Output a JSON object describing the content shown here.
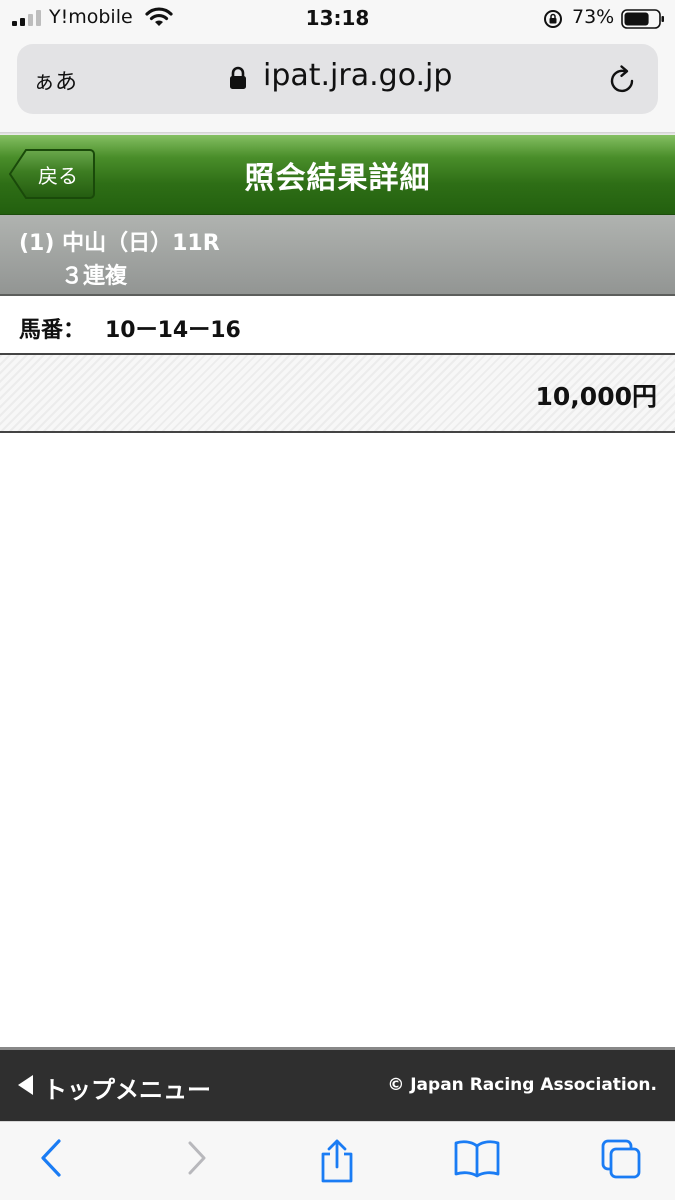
{
  "status_bar": {
    "carrier": "Y!mobile",
    "time": "13:18",
    "battery_percent": "73%",
    "battery_level": 0.73,
    "signal_bars": 2
  },
  "address_bar": {
    "text_size_button": "ぁあ",
    "url": "ipat.jra.go.jp"
  },
  "header": {
    "back_label": "戻る",
    "title": "照会結果詳細"
  },
  "race": {
    "line1": "(1) 中山（日）11R",
    "line2": "３連複"
  },
  "bet": {
    "horse_label": "馬番：",
    "horse_combination": "10ー14ー16",
    "amount": "10,000円"
  },
  "footer": {
    "top_menu_label": "トップメニュー",
    "copyright": "© Japan Racing Association."
  },
  "colors": {
    "header_green": "#2e6e16",
    "band_gray": "#929593",
    "footer_dark": "#2f2f2f",
    "ios_blue": "#1a7cf4"
  }
}
